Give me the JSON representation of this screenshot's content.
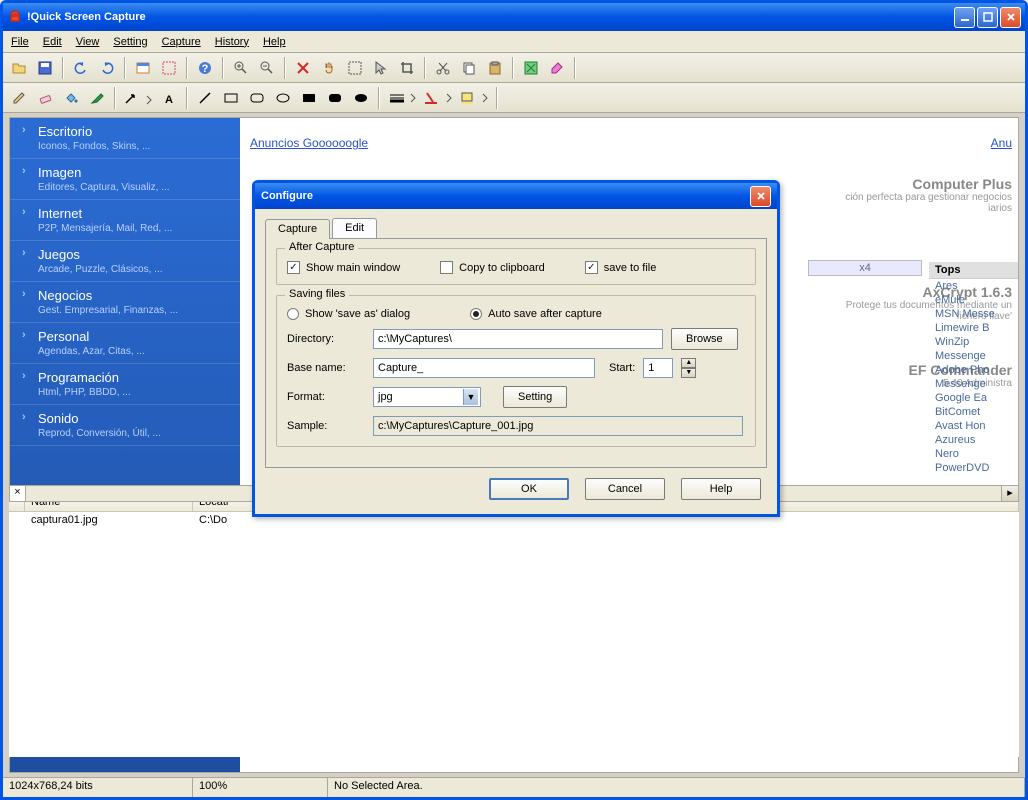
{
  "window": {
    "title": "!Quick Screen Capture",
    "menubar": [
      "File",
      "Edit",
      "View",
      "Setting",
      "Capture",
      "History",
      "Help"
    ]
  },
  "sidebar": {
    "items": [
      {
        "cat": "Escritorio",
        "sub": "Iconos, Fondos, Skins, ..."
      },
      {
        "cat": "Imagen",
        "sub": "Editores, Captura, Visualiz, ..."
      },
      {
        "cat": "Internet",
        "sub": "P2P, Mensajería, Mail, Red, ..."
      },
      {
        "cat": "Juegos",
        "sub": "Arcade, Puzzle, Clásicos, ..."
      },
      {
        "cat": "Negocios",
        "sub": "Gest. Empresarial, Finanzas, ..."
      },
      {
        "cat": "Personal",
        "sub": "Agendas, Azar, Citas, ..."
      },
      {
        "cat": "Programación",
        "sub": "Html, PHP, BBDD, ..."
      },
      {
        "cat": "Sonido",
        "sub": "Reprod, Conversión, Útil, ..."
      }
    ]
  },
  "mainpane": {
    "anuncios": "Anuncios Goooooogle",
    "anu_right": "Anu",
    "computer_plus": "Computer Plus",
    "computer_plus_sub1": "ción perfecta para gestionar negocios",
    "computer_plus_sub2": "iarios",
    "x4": "x4",
    "axcrypt_title": "AxCrypt 1.6.3",
    "axcrypt_sub": "Protege tus documentos mediante un 'fichero llave'",
    "ef_title": "EF Commander",
    "ef_sub": "5.40 Administra",
    "tops_header": "Tops",
    "tops": [
      "Ares",
      "eMule",
      "MSN Messe",
      "Limewire B",
      "WinZip",
      "Messenge",
      "Adobe Pho",
      "Messenge",
      "Google Ea",
      "BitComet",
      "Avast Hon",
      "Azureus",
      "Nero",
      "PowerDVD"
    ]
  },
  "files": {
    "col_name": "Name",
    "col_loc": "Locati",
    "row_name": "captura01.jpg",
    "row_loc": "C:\\Do"
  },
  "status": {
    "res": "1024x768,24 bits",
    "zoom": "100%",
    "sel": "No Selected Area."
  },
  "dialog": {
    "title": "Configure",
    "tabs": {
      "capture": "Capture",
      "edit": "Edit"
    },
    "after_capture": {
      "legend": "After Capture",
      "show_main": "Show main window",
      "copy_clip": "Copy to clipboard",
      "save_file": "save to file"
    },
    "saving": {
      "legend": "Saving files",
      "show_saveas": "Show 'save as' dialog",
      "auto_save": "Auto save after capture",
      "dir_label": "Directory:",
      "dir_value": "c:\\MyCaptures\\",
      "browse": "Browse",
      "base_label": "Base name:",
      "base_value": "Capture_",
      "start_label": "Start:",
      "start_value": "1",
      "format_label": "Format:",
      "format_value": "jpg",
      "setting": "Setting",
      "sample_label": "Sample:",
      "sample_value": "c:\\MyCaptures\\Capture_001.jpg"
    },
    "buttons": {
      "ok": "OK",
      "cancel": "Cancel",
      "help": "Help"
    }
  }
}
